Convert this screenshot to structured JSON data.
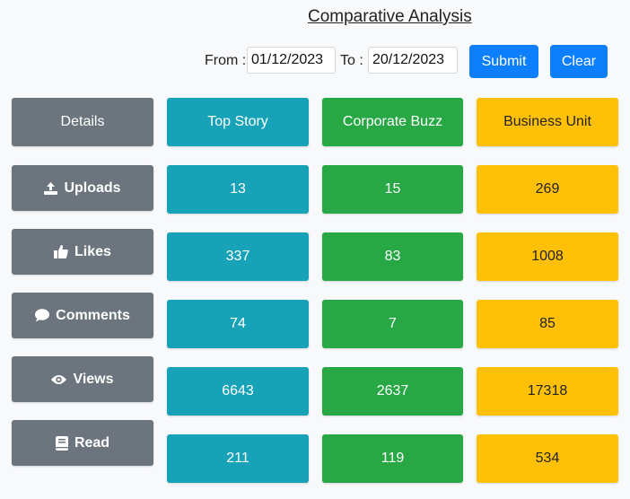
{
  "title": "Comparative Analysis",
  "filter": {
    "from_label": "From :",
    "from_value": "01/12/2023",
    "to_label": "To :",
    "to_value": "20/12/2023",
    "submit_label": "Submit",
    "clear_label": "Clear"
  },
  "columns": {
    "details": "Details",
    "top_story": "Top Story",
    "corporate_buzz": "Corporate Buzz",
    "business_unit": "Business Unit"
  },
  "rows": [
    {
      "label": "Uploads",
      "icon": "upload-icon",
      "top_story": "13",
      "corporate_buzz": "15",
      "business_unit": "269"
    },
    {
      "label": "Likes",
      "icon": "thumbs-up-icon",
      "top_story": "337",
      "corporate_buzz": "83",
      "business_unit": "1008"
    },
    {
      "label": "Comments",
      "icon": "comment-icon",
      "top_story": "74",
      "corporate_buzz": "7",
      "business_unit": "85"
    },
    {
      "label": "Views",
      "icon": "eye-icon",
      "top_story": "6643",
      "corporate_buzz": "2637",
      "business_unit": "17318"
    },
    {
      "label": "Read",
      "icon": "book-icon",
      "top_story": "211",
      "corporate_buzz": "119",
      "business_unit": "534"
    }
  ],
  "colors": {
    "details": "#6c757d",
    "top_story": "#17a2b8",
    "corporate_buzz": "#28a745",
    "business_unit": "#ffc107",
    "button": "#0d7efc"
  }
}
